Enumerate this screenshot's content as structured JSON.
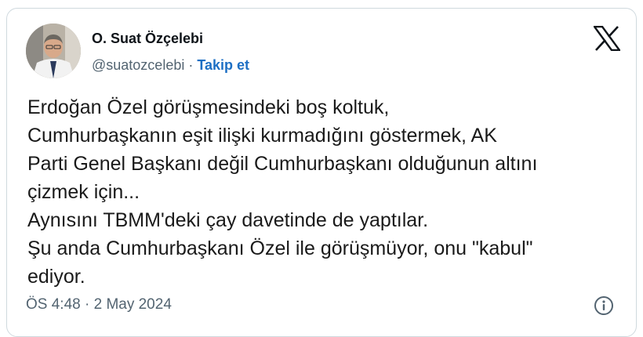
{
  "author": {
    "name": "O. Suat Özçelebi",
    "handle": "@suatozcelebi",
    "separator": " · ",
    "follow_label": "Takip et"
  },
  "tweet": {
    "lines": [
      "Erdoğan Özel görüşmesindeki boş koltuk,",
      "Cumhurbaşkanın eşit ilişki kurmadığını göstermek, AK",
      "Parti Genel Başkanı değil Cumhurbaşkanı olduğunun altını",
      "çizmek için...",
      "Aynısını TBMM'deki çay davetinde de yaptılar.",
      "Şu anda Cumhurbaşkanı Özel ile görüşmüyor, onu \"kabul\"",
      "ediyor."
    ]
  },
  "meta": {
    "timestamp": "ÖS 4:48 · 2 May 2024"
  },
  "icons": {
    "logo": "x-logo-icon",
    "info": "info-icon"
  },
  "colors": {
    "follow": "#1d6fc4",
    "muted": "#536471",
    "text": "#0f1419",
    "border": "#cfd9de"
  }
}
